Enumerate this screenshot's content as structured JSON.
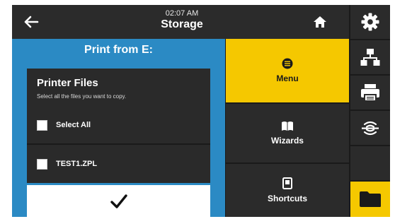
{
  "header": {
    "time": "02:07 AM",
    "title": "Storage",
    "back_icon": "back-arrow-icon",
    "home_icon": "home-icon"
  },
  "dialog": {
    "title": "Print from E:",
    "panel_title": "Printer Files",
    "description": "Select all the files you want to copy.",
    "options": [
      {
        "label": "Select All",
        "checked": false
      },
      {
        "label": "TEST1.ZPL",
        "checked": false
      }
    ],
    "confirm_icon": "checkmark-icon"
  },
  "nav": {
    "menu": {
      "label": "Menu",
      "icon": "menu-icon",
      "active": true
    },
    "wizards": {
      "label": "Wizards",
      "icon": "book-icon"
    },
    "shortcuts": {
      "label": "Shortcuts",
      "icon": "bookmark-icon"
    }
  },
  "sidebar": {
    "items": [
      {
        "icon": "gear-icon"
      },
      {
        "icon": "network-icon"
      },
      {
        "icon": "printer-icon"
      },
      {
        "icon": "wireless-icon"
      },
      {
        "icon": "folder-icon",
        "active": true
      }
    ]
  },
  "colors": {
    "accent": "#f5c800",
    "dialog_blue": "#2b8ac4",
    "dark": "#2b2b2b",
    "background": "#1a1a1a"
  }
}
